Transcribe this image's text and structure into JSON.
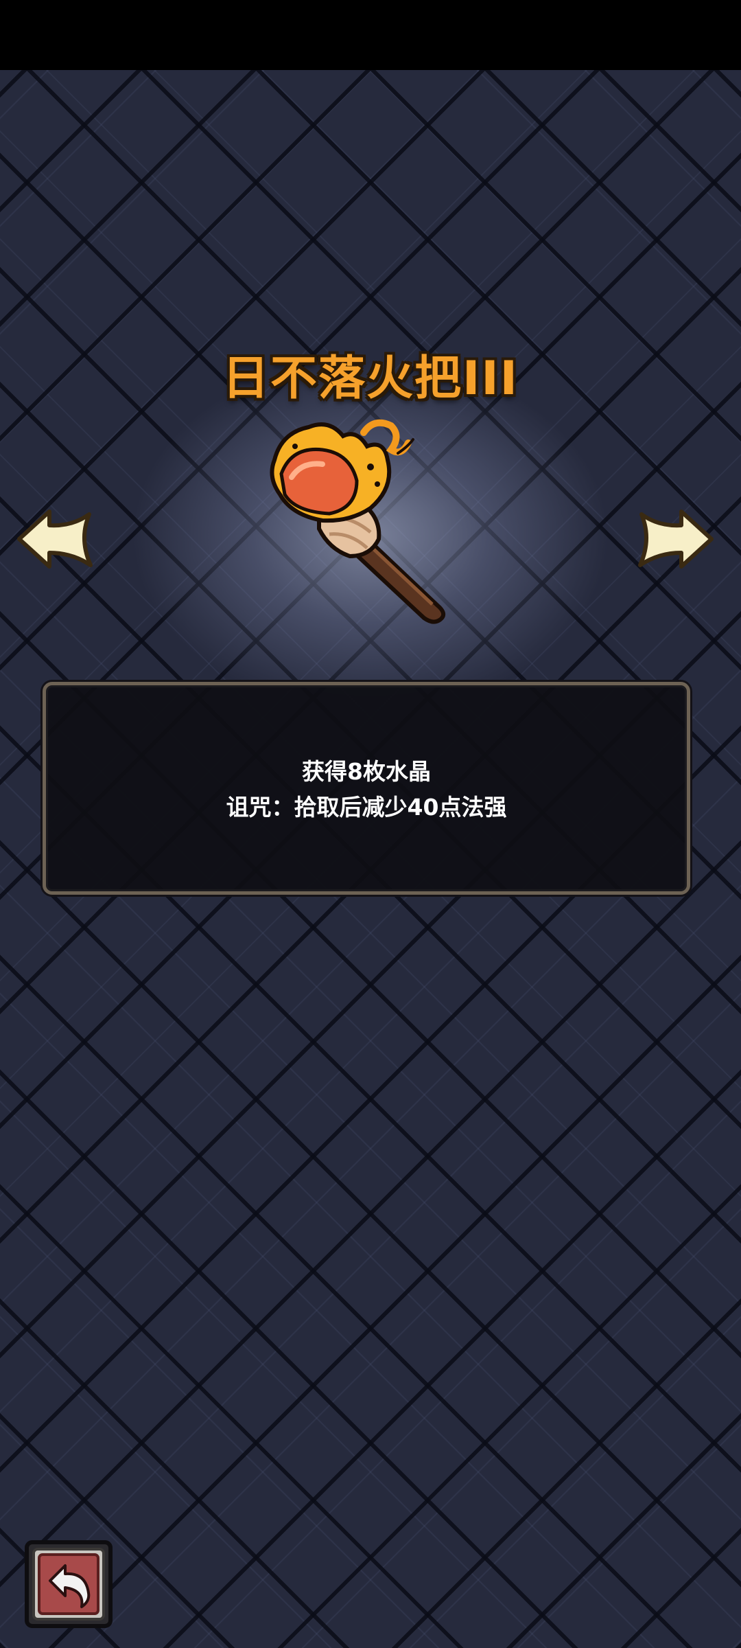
{
  "item": {
    "title": "日不落火把III",
    "image_icon": "torch-icon"
  },
  "navigation": {
    "prev_icon": "left-arrow-icon",
    "next_icon": "right-arrow-icon"
  },
  "description": {
    "lines": [
      "获得8枚水晶",
      "诅咒：拾取后减少40点法强"
    ]
  },
  "back_button": {
    "icon": "return-icon"
  },
  "colors": {
    "title": "#f6a12c",
    "background": "#262a3d",
    "panel_border": "#6d6254",
    "back_button": "#a84a4a"
  }
}
